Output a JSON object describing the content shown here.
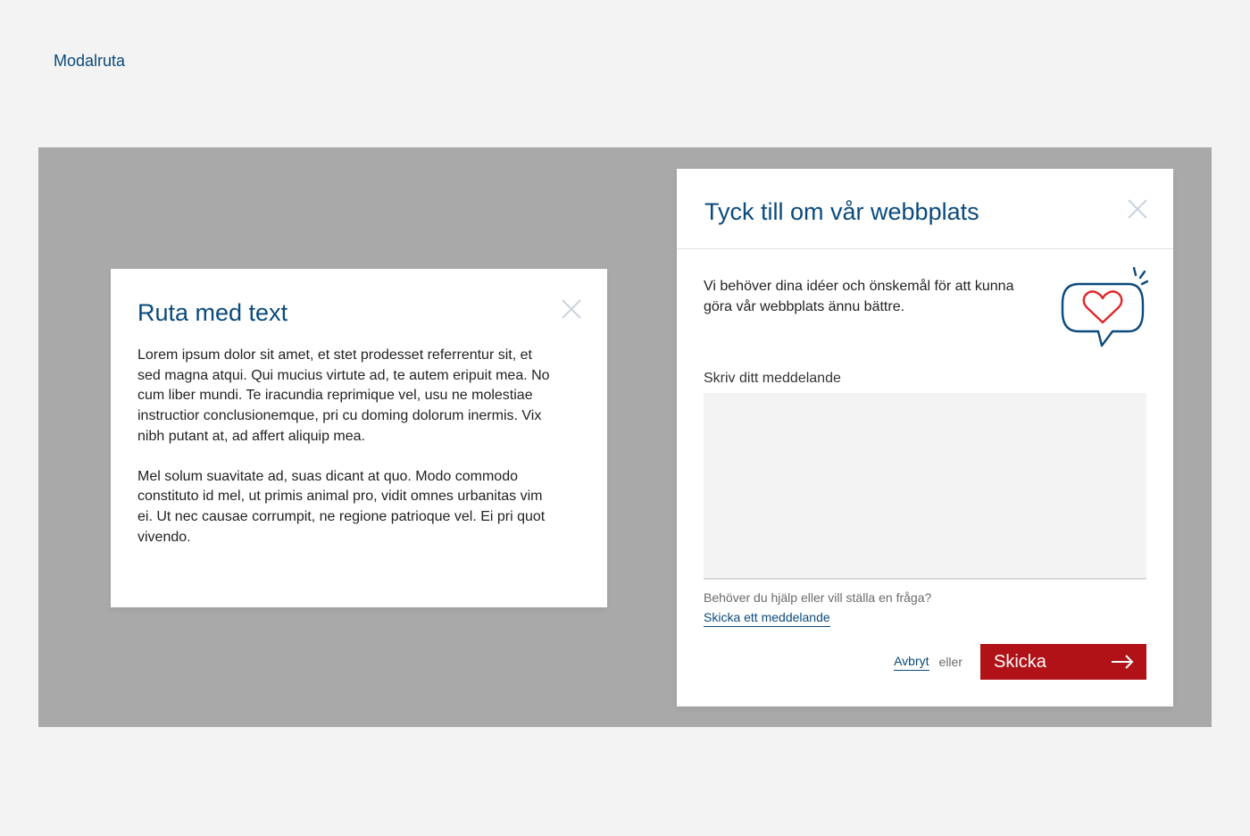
{
  "page": {
    "heading": "Modalruta"
  },
  "text_modal": {
    "title": "Ruta med text",
    "close_icon": "close-icon",
    "paragraphs": [
      "Lorem ipsum dolor sit amet, et stet prodesset referrentur sit, et sed magna atqui. Qui mucius virtute ad, te autem eripuit mea. No cum liber mundi. Te iracundia reprimique vel, usu ne molestiae instructior conclusionemque, pri cu doming dolorum inermis. Vix nibh putant at, ad affert aliquip mea.",
      "Mel solum suavitate ad, suas dicant at quo. Modo commodo constituto id mel, ut primis animal pro, vidit omnes urbanitas vim ei. Ut nec causae corrumpit, ne regione patrioque vel. Ei pri quot vivendo."
    ]
  },
  "feedback_modal": {
    "title": "Tyck till om vår webbplats",
    "close_icon": "close-icon",
    "intro": "Vi behöver dina idéer och önskemål för att kunna göra vår webbplats ännu bättre.",
    "illustration_icon": "speech-bubble-heart-icon",
    "message_label": "Skriv ditt meddelande",
    "message_value": "",
    "help_text": "Behöver du hjälp eller vill ställa en fråga?",
    "help_link": "Skicka ett meddelande",
    "cancel_label": "Avbryt",
    "or_text": "eller",
    "submit_label": "Skicka",
    "submit_icon": "arrow-right-icon"
  },
  "colors": {
    "page_background": "#f3f3f3",
    "overlay": "#a9a9a9",
    "heading_blue": "#0a4a7c",
    "submit_red": "#b01217",
    "heart_red": "#e0262b",
    "close_gray": "#c9d2dc"
  }
}
